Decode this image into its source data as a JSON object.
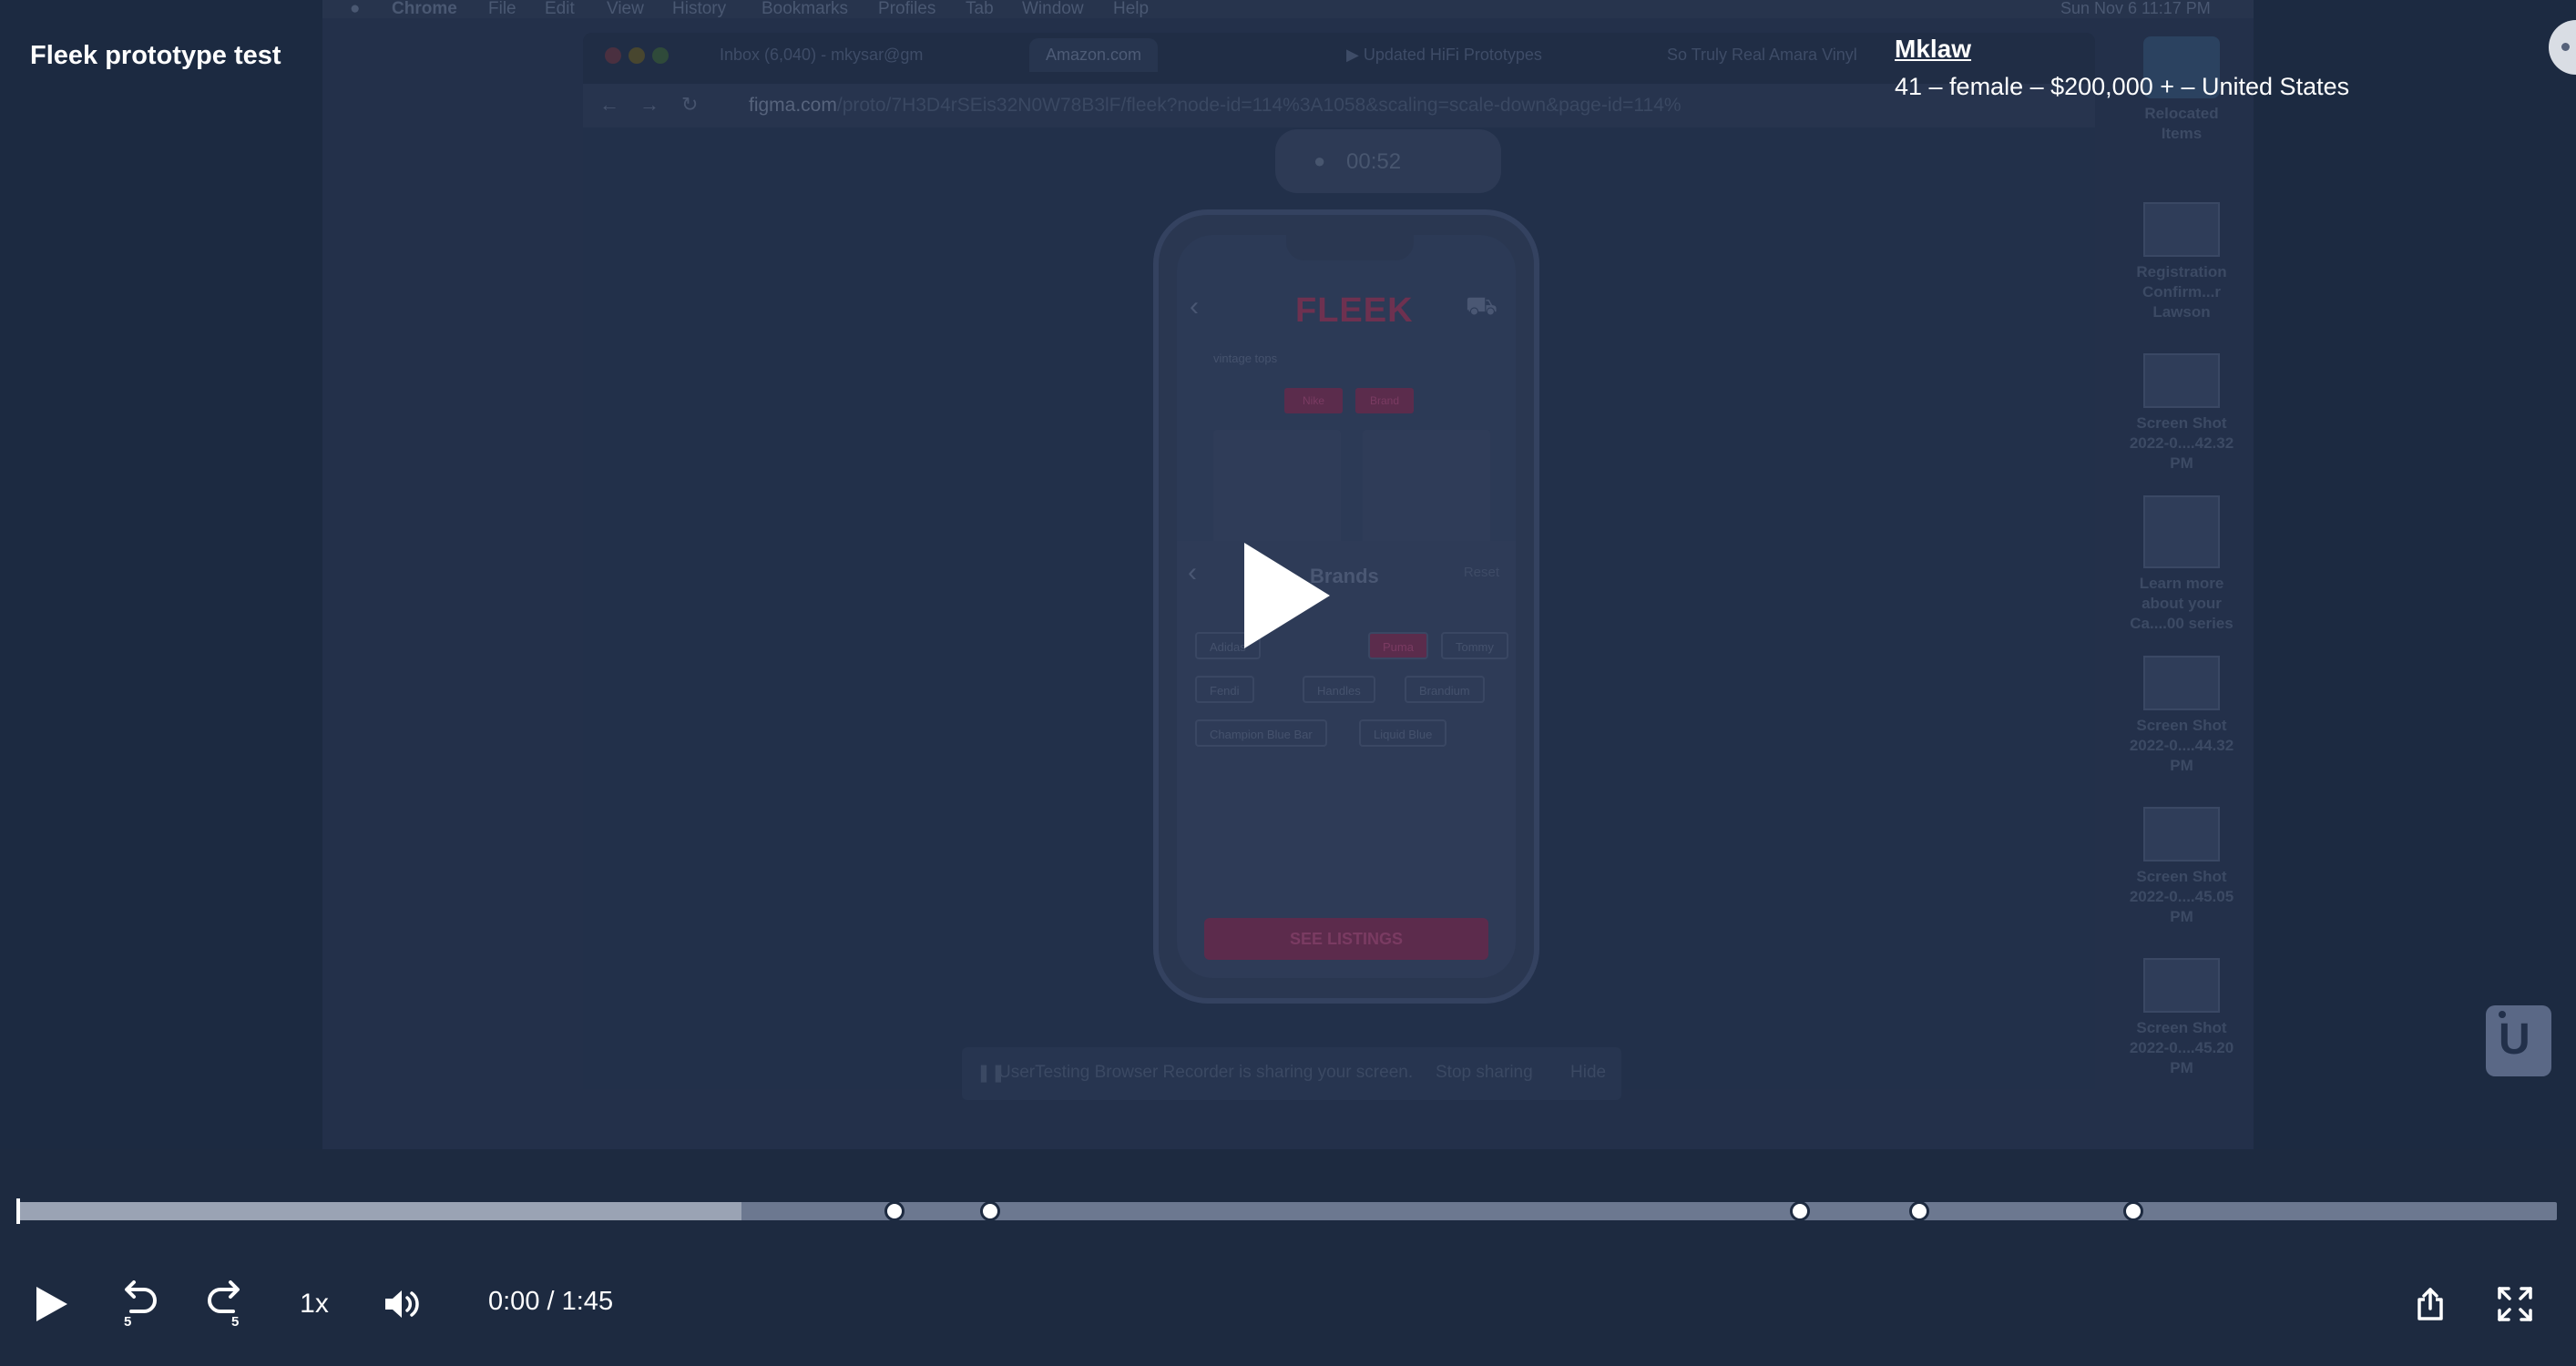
{
  "player": {
    "title": "Fleek prototype test",
    "participant_name": "Mklaw",
    "participant_meta": "41 – female – $200,000 + – United States",
    "speed": "1x",
    "time_current": "0:00",
    "time_separator": " / ",
    "time_total": "1:45",
    "progress_buffered": 0.285,
    "markers": [
      0.345,
      0.383,
      0.702,
      0.749,
      0.833
    ],
    "skip_seconds": "5"
  },
  "recording": {
    "mac_menu": [
      "Chrome",
      "File",
      "Edit",
      "View",
      "History",
      "Bookmarks",
      "Profiles",
      "Tab",
      "Window",
      "Help"
    ],
    "clock": "Sun Nov 6  11:17 PM",
    "tabs": [
      "Inbox (6,040) - mkysar@gm",
      "Amazon.com",
      "▶ Updated HiFi Prototypes",
      "So Truly Real Amara Vinyl"
    ],
    "url_host": "figma.com",
    "url_path": "/proto/7H3D4rSEis32N0W78B3lF/fleek?node-id=114%3A1058&scaling=scale-down&page-id=114%",
    "rec_timer": "00:52",
    "app_logo": "FLEEK",
    "search_hint": "vintage tops",
    "chip_labels": [
      "Nike",
      "Brand"
    ],
    "brands_title": "Brands",
    "brands_reset": "Reset",
    "brand_chips": [
      "Adidas",
      "Puma",
      "Tommy",
      "Fendi",
      "Handles",
      "Brandium",
      "Champion Blue Bar",
      "Liquid Blue"
    ],
    "see_listings": "SEE LISTINGS",
    "share_text": "UserTesting Browser Recorder is sharing your screen.",
    "share_stop": "Stop sharing",
    "share_hide": "Hide",
    "desktop_items": [
      "Relocated Items",
      "Registration Confirm...r Lawson",
      "Screen Shot 2022-0....42.32 PM",
      "Learn more about your Ca....00 series",
      "Screen Shot 2022-0....44.32 PM",
      "Screen Shot 2022-0....45.05 PM",
      "Screen Shot 2022-0....45.20 PM"
    ]
  }
}
